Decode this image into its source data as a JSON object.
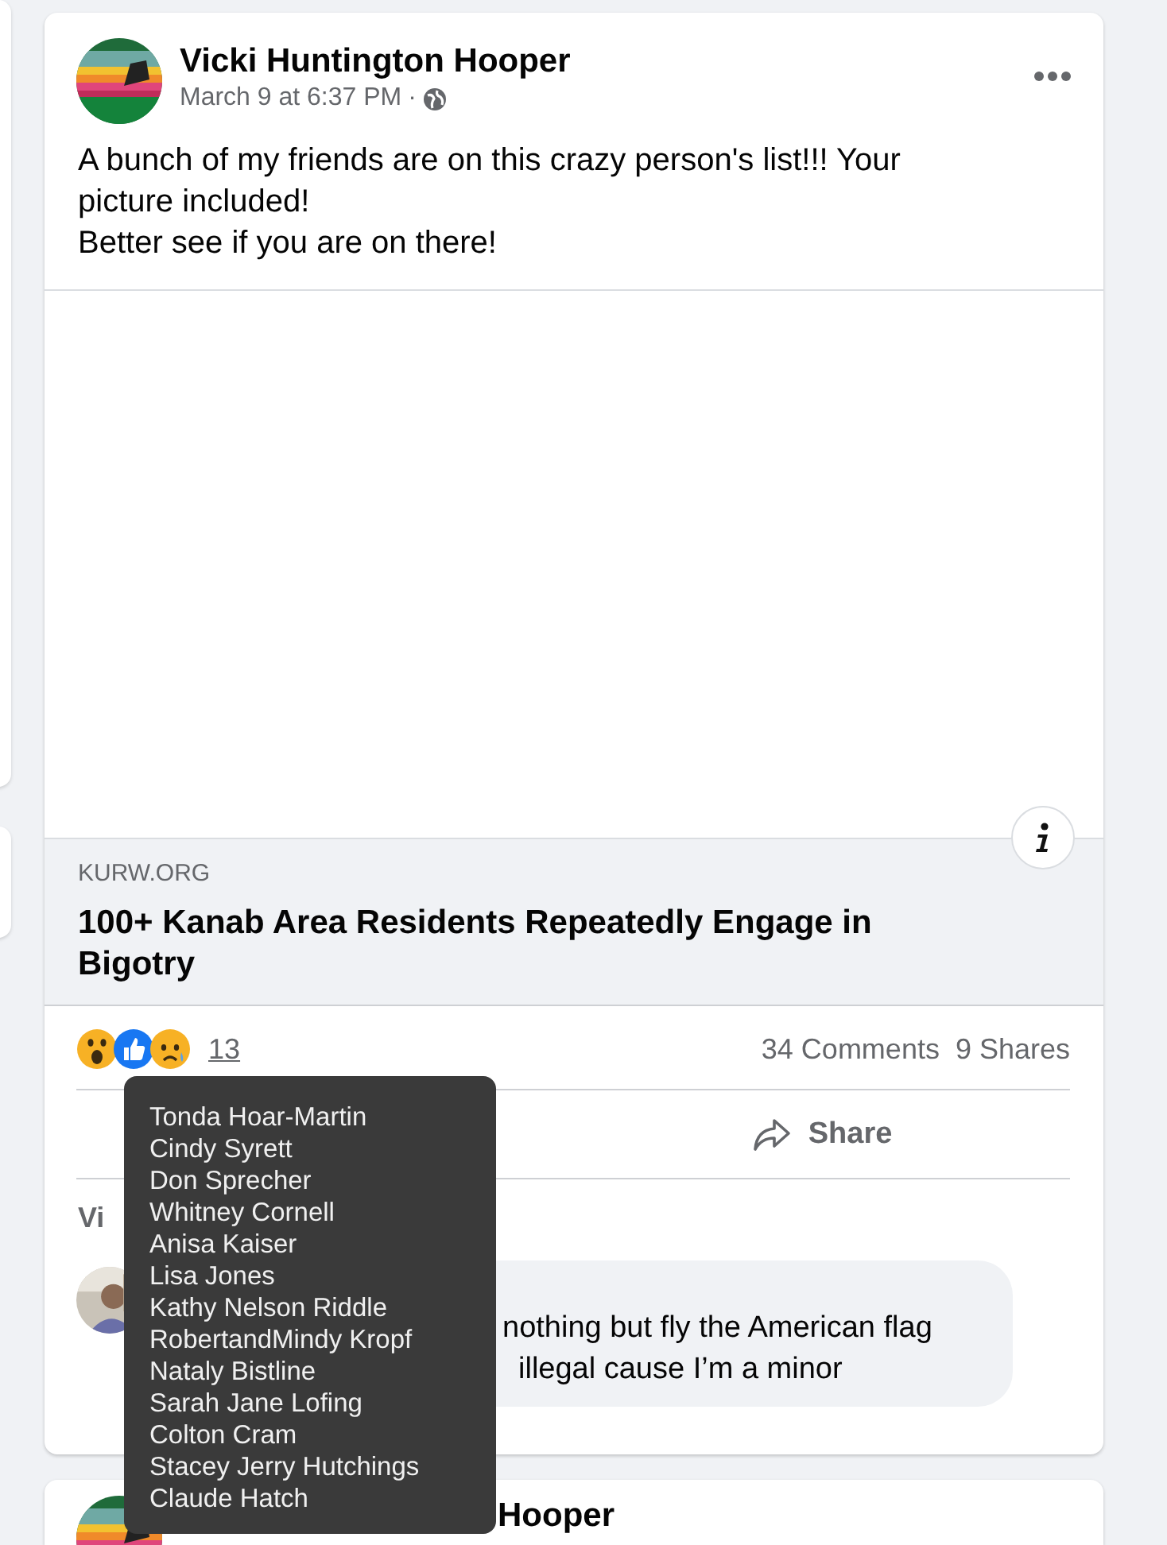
{
  "post": {
    "author": "Vicki Huntington Hooper",
    "timestamp": "March 9 at 6:37 PM",
    "separator": "·",
    "text_lines": [
      "A bunch of my friends are on this crazy person's list!!! Your picture included!",
      "Better see if you are on there!"
    ],
    "link": {
      "domain": "KURW.ORG",
      "title": "100+ Kanab Area Residents Repeatedly Engage in Bigotry"
    },
    "reactions": {
      "count": "13",
      "comments": "34 Comments",
      "shares": "9 Shares"
    },
    "actions": [
      {
        "kind": "share",
        "label": "Share"
      }
    ],
    "view_more": "Vi",
    "comment": {
      "lines": [
        "nothing but fly the American flag",
        "illegal cause I’m a minor"
      ]
    }
  },
  "tooltip": {
    "names": [
      "Tonda Hoar-Martin",
      "Cindy Syrett",
      "Don Sprecher",
      "Whitney Cornell",
      "Anisa Kaiser",
      "Lisa Jones",
      "Kathy Nelson Riddle",
      "RobertandMindy Kropf",
      "Nataly Bistline",
      "Sarah Jane Lofing",
      "Colton Cram",
      "Stacey Jerry Hutchings",
      "Claude Hatch"
    ]
  },
  "next_post": {
    "author": "Hooper"
  }
}
